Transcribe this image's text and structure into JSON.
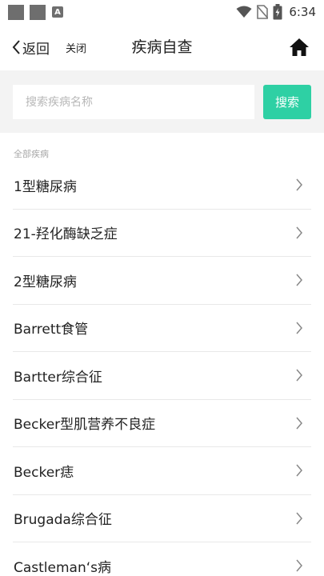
{
  "status_bar": {
    "time": "6:34",
    "notification_glyph": "A",
    "icons": [
      "square-icon",
      "square-icon",
      "a-icon",
      "wifi-icon",
      "no-sim-icon",
      "battery-icon"
    ]
  },
  "nav": {
    "back_label": "返回",
    "close_label": "关闭",
    "title": "疾病自查",
    "home_icon": "home-icon"
  },
  "search": {
    "placeholder": "搜索疾病名称",
    "value": "",
    "button_label": "搜索",
    "accent_color": "#2ed0a4"
  },
  "list": {
    "section_label": "全部疾病",
    "items": [
      {
        "label": "1型糖尿病"
      },
      {
        "label": "21-羟化酶缺乏症"
      },
      {
        "label": "2型糖尿病"
      },
      {
        "label": "Barrett食管"
      },
      {
        "label": "Bartter综合征"
      },
      {
        "label": "Becker型肌营养不良症"
      },
      {
        "label": "Becker痣"
      },
      {
        "label": "Brugada综合征"
      },
      {
        "label": "Castleman‘s病"
      }
    ]
  }
}
